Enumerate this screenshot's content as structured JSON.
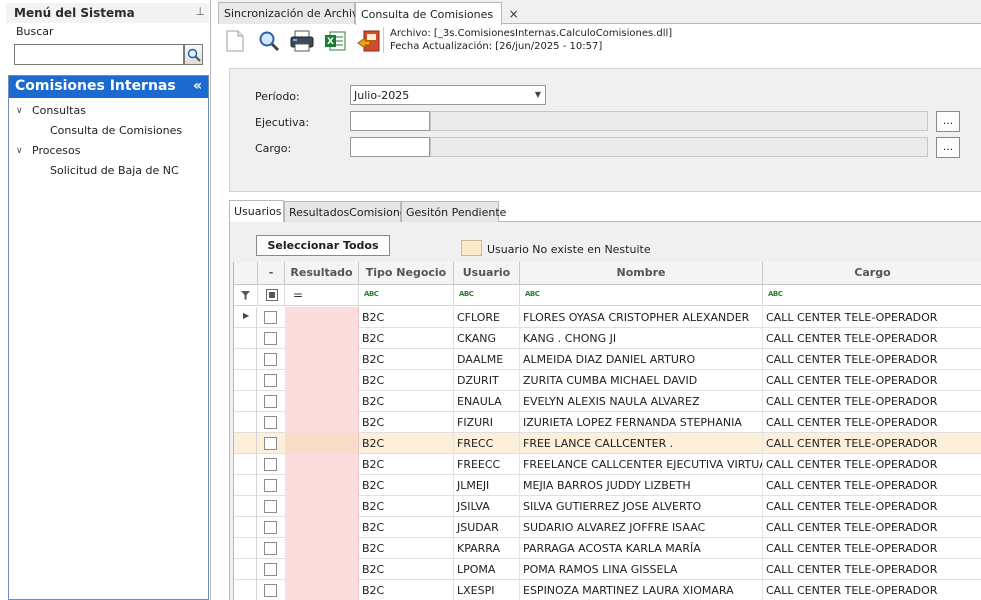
{
  "left_panel": {
    "title": "Menú del Sistema",
    "search_label": "Buscar",
    "search_value": "",
    "group_title": "Comisiones Internas",
    "tree": [
      {
        "label": "Consultas",
        "expanded": true,
        "children": [
          {
            "label": "Consulta de Comisiones"
          }
        ]
      },
      {
        "label": "Procesos",
        "expanded": true,
        "children": [
          {
            "label": "Solicitud de Baja de NC"
          }
        ]
      }
    ]
  },
  "tabs": [
    {
      "label": "Sincronización de Archivos",
      "active": false
    },
    {
      "label": "Consulta de Comisiones",
      "active": true,
      "close": "×"
    }
  ],
  "toolbar": {
    "buttons": [
      "new-document-icon",
      "search-icon",
      "print-icon",
      "excel-export-icon",
      "exit-icon"
    ],
    "archivo": "Archivo: [_3s.ComisionesInternas.CalculoComisiones.dll]",
    "fecha": "Fecha Actualización: [26/jun/2025 - 10:57]"
  },
  "filters": {
    "periodo_label": "Período:",
    "periodo_value": "Julio-2025",
    "ejecutiva_label": "Ejecutiva:",
    "ejecutiva_value": "",
    "cargo_label": "Cargo:",
    "cargo_value": "",
    "browse_label": "..."
  },
  "lower_tabs": [
    {
      "label": "Usuarios",
      "active": true
    },
    {
      "label": "ResultadosComisiones",
      "active": false
    },
    {
      "label": "Gesitón Pendiente",
      "active": false
    }
  ],
  "select_all_label": "Seleccionar Todos",
  "legend_label": "Usuario No existe en Nestuite",
  "grid": {
    "columns": {
      "check": "-",
      "resultado": "Resultado",
      "tipo": "Tipo Negocio",
      "usuario": "Usuario",
      "nombre": "Nombre",
      "cargo": "Cargo"
    },
    "filter_equals": "=",
    "filter_abc": "ABC",
    "rows": [
      {
        "tipo": "B2C",
        "usuario": "CFLORE",
        "nombre": "FLORES OYASA CRISTOPHER ALEXANDER",
        "cargo": "CALL CENTER TELE-OPERADOR",
        "highlight": false
      },
      {
        "tipo": "B2C",
        "usuario": "CKANG",
        "nombre": "KANG . CHONG JI",
        "cargo": "CALL CENTER TELE-OPERADOR",
        "highlight": false
      },
      {
        "tipo": "B2C",
        "usuario": "DAALME",
        "nombre": "ALMEIDA DIAZ DANIEL ARTURO",
        "cargo": "CALL CENTER TELE-OPERADOR",
        "highlight": false
      },
      {
        "tipo": "B2C",
        "usuario": "DZURIT",
        "nombre": "ZURITA CUMBA MICHAEL DAVID",
        "cargo": "CALL CENTER TELE-OPERADOR",
        "highlight": false
      },
      {
        "tipo": "B2C",
        "usuario": "ENAULA",
        "nombre": "EVELYN ALEXIS NAULA ALVAREZ",
        "cargo": "CALL CENTER TELE-OPERADOR",
        "highlight": false
      },
      {
        "tipo": "B2C",
        "usuario": "FIZURI",
        "nombre": "IZURIETA LOPEZ FERNANDA STEPHANIA",
        "cargo": "CALL CENTER TELE-OPERADOR",
        "highlight": false
      },
      {
        "tipo": "B2C",
        "usuario": "FRECC",
        "nombre": "FREE LANCE CALLCENTER .",
        "cargo": "CALL CENTER TELE-OPERADOR",
        "highlight": true
      },
      {
        "tipo": "B2C",
        "usuario": "FREECC",
        "nombre": "FREELANCE CALLCENTER EJECUTIVA VIRTUAL",
        "cargo": "CALL CENTER TELE-OPERADOR",
        "highlight": false
      },
      {
        "tipo": "B2C",
        "usuario": "JLMEJI",
        "nombre": "MEJIA BARROS JUDDY LIZBETH",
        "cargo": "CALL CENTER TELE-OPERADOR",
        "highlight": false
      },
      {
        "tipo": "B2C",
        "usuario": "JSILVA",
        "nombre": "SILVA GUTIERREZ JOSE ALVERTO",
        "cargo": "CALL CENTER TELE-OPERADOR",
        "highlight": false
      },
      {
        "tipo": "B2C",
        "usuario": "JSUDAR",
        "nombre": "SUDARIO ALVAREZ JOFFRE ISAAC",
        "cargo": "CALL CENTER TELE-OPERADOR",
        "highlight": false
      },
      {
        "tipo": "B2C",
        "usuario": "KPARRA",
        "nombre": "PARRAGA ACOSTA KARLA MARÍA",
        "cargo": "CALL CENTER TELE-OPERADOR",
        "highlight": false
      },
      {
        "tipo": "B2C",
        "usuario": "LPOMA",
        "nombre": "POMA RAMOS LINA GISSELA",
        "cargo": "CALL CENTER TELE-OPERADOR",
        "highlight": false
      },
      {
        "tipo": "B2C",
        "usuario": "LXESPI",
        "nombre": "ESPINOZA MARTINEZ LAURA XIOMARA",
        "cargo": "CALL CENTER TELE-OPERADOR",
        "highlight": false
      }
    ]
  },
  "colors": {
    "accent": "#1b6ad0",
    "resultado_bg": "#fcdcdc",
    "highlight_row": "#fdf0db",
    "legend_swatch": "#fdebc8"
  }
}
